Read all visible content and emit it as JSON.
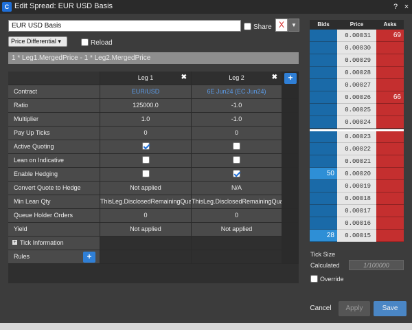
{
  "titlebar": {
    "title": "Edit Spread: EUR USD Basis",
    "help_label": "?",
    "close_label": "×"
  },
  "top": {
    "spread_name": "EUR USD Basis",
    "share_label": "Share",
    "color_value": "X",
    "differential_label": "Price Differential ▾",
    "reload_label": "Reload",
    "formula": "1 * Leg1.MergedPrice - 1 * Leg2.MergedPrice"
  },
  "legs": {
    "leg1": {
      "header": "Leg 1"
    },
    "leg2": {
      "header": "Leg 2"
    },
    "close_icon": "✖",
    "add_icon": "+"
  },
  "rows": {
    "contract": {
      "label": "Contract",
      "leg1": "EUR/USD",
      "leg2": "6E Jun24 (EC Jun24)"
    },
    "ratio": {
      "label": "Ratio",
      "leg1": "125000.0",
      "leg2": "-1.0"
    },
    "multiplier": {
      "label": "Multiplier",
      "leg1": "1.0",
      "leg2": "-1.0"
    },
    "payup": {
      "label": "Pay Up Ticks",
      "leg1": "0",
      "leg2": "0"
    },
    "active_quoting": {
      "label": "Active Quoting",
      "leg1_checked": true,
      "leg2_checked": false
    },
    "lean_indicative": {
      "label": "Lean on Indicative",
      "leg1_checked": false,
      "leg2_checked": false
    },
    "enable_hedging": {
      "label": "Enable Hedging",
      "leg1_checked": false,
      "leg2_checked": true
    },
    "convert_quote": {
      "label": "Convert Quote to Hedge",
      "leg1": "Not applied",
      "leg2": "N/A"
    },
    "min_lean": {
      "label": "Min Lean Qty",
      "leg1": "ThisLeg.DisclosedRemainingQuantity",
      "leg2": "ThisLeg.DisclosedRemainingQuantity"
    },
    "queue_holder": {
      "label": "Queue Holder Orders",
      "leg1": "0",
      "leg2": "0"
    },
    "yield": {
      "label": "Yield",
      "leg1": "Not applied",
      "leg2": "Not applied"
    },
    "tick_info": {
      "label": "Tick Information",
      "icon": "+"
    },
    "rules": {
      "label": "Rules",
      "add_icon": "+"
    }
  },
  "ladder": {
    "headers": {
      "bids": "Bids",
      "price": "Price",
      "asks": "Asks"
    },
    "rows": [
      {
        "price": "0.00031",
        "bid": "",
        "ask": "69"
      },
      {
        "price": "0.00030",
        "bid": "",
        "ask": ""
      },
      {
        "price": "0.00029",
        "bid": "",
        "ask": ""
      },
      {
        "price": "0.00028",
        "bid": "",
        "ask": ""
      },
      {
        "price": "0.00027",
        "bid": "",
        "ask": ""
      },
      {
        "price": "0.00026",
        "bid": "",
        "ask": "66"
      },
      {
        "price": "0.00025",
        "bid": "",
        "ask": ""
      },
      {
        "price": "0.00024",
        "bid": "",
        "ask": ""
      },
      {
        "price": "0.00023",
        "bid": "",
        "ask": ""
      },
      {
        "price": "0.00022",
        "bid": "",
        "ask": ""
      },
      {
        "price": "0.00021",
        "bid": "",
        "ask": ""
      },
      {
        "price": "0.00020",
        "bid": "50",
        "ask": ""
      },
      {
        "price": "0.00019",
        "bid": "",
        "ask": ""
      },
      {
        "price": "0.00018",
        "bid": "",
        "ask": ""
      },
      {
        "price": "0.00017",
        "bid": "",
        "ask": ""
      },
      {
        "price": "0.00016",
        "bid": "",
        "ask": ""
      },
      {
        "price": "0.00015",
        "bid": "28",
        "ask": ""
      }
    ]
  },
  "tick": {
    "size_label": "Tick Size",
    "calculated_label": "Calculated",
    "calculated_value": "1/100000",
    "override_label": "Override"
  },
  "footer": {
    "cancel": "Cancel",
    "apply": "Apply",
    "save": "Save"
  },
  "colors": {
    "accent": "#2f7fd6",
    "bid": "#1a6aa8",
    "ask": "#c42f2f",
    "save": "#4a86c5"
  }
}
